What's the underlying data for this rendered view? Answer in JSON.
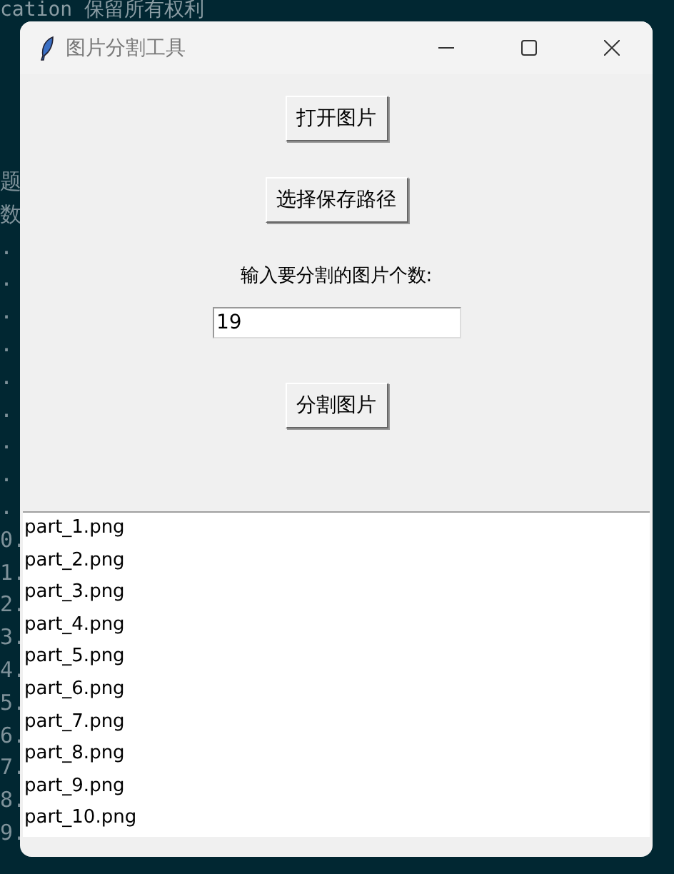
{
  "terminal": {
    "header": "cation  保留所有权利",
    "lines": [
      "题",
      "数",
      ".",
      ".",
      ".",
      ".",
      ".",
      ".",
      ".",
      ".",
      ".",
      "0.",
      "1.",
      "2.",
      "3.",
      "4.",
      "5.",
      "6.",
      "7.",
      "8.",
      "9."
    ]
  },
  "window": {
    "title": "图片分割工具"
  },
  "open_button": "打开图片",
  "save_path_button": "选择保存路径",
  "count_label": "输入要分割的图片个数:",
  "count_field": {
    "value": "19"
  },
  "split_button": "分割图片",
  "file_list": [
    "part_1.png",
    "part_2.png",
    "part_3.png",
    "part_4.png",
    "part_5.png",
    "part_6.png",
    "part_7.png",
    "part_8.png",
    "part_9.png",
    "part_10.png"
  ]
}
